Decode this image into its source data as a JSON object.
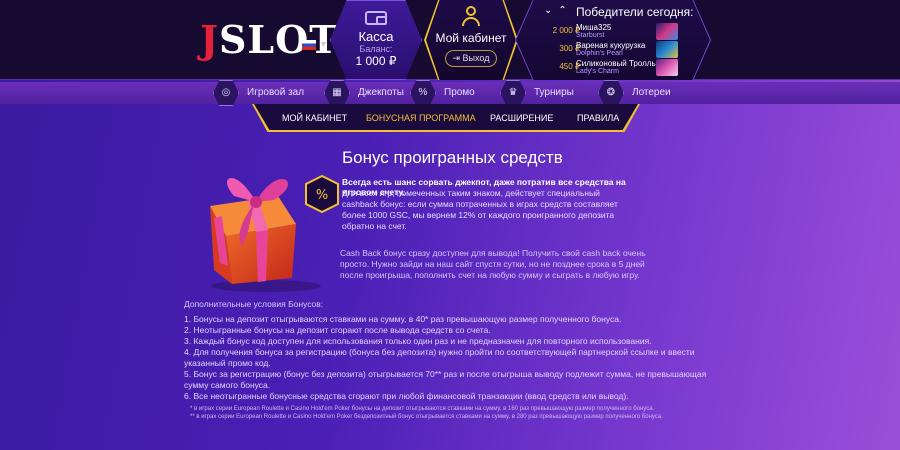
{
  "header": {
    "logo_text": "JSLOT",
    "kassa": {
      "title": "Касса",
      "balance_label": "Баланс:",
      "balance_amount": "1 000 ₽"
    },
    "cabinet": {
      "title": "Мой кабинет",
      "logout_label": "Выход"
    },
    "winners": {
      "title": "Победители сегодня:",
      "rows": [
        {
          "amount": "2 000 ₽",
          "name": "Миша325",
          "game": "Starburst"
        },
        {
          "amount": "300 ₽",
          "name": "Вареная кукурузка",
          "game": "Dolphin's Pearl"
        },
        {
          "amount": "450 ₽",
          "name": "Силиконовый Тролль",
          "game": "Lady's Charm"
        }
      ]
    }
  },
  "main_nav": [
    {
      "label": "Игровой зал",
      "icon": "target-icon"
    },
    {
      "label": "Джекпоты",
      "icon": "slot-reels-icon"
    },
    {
      "label": "Промо",
      "icon": "promo-icon"
    },
    {
      "label": "Турниры",
      "icon": "trophy-icon"
    },
    {
      "label": "Лотереи",
      "icon": "lottery-balls-icon"
    }
  ],
  "sub_nav": [
    {
      "label": "МОЙ КАБИНЕТ",
      "active": false
    },
    {
      "label": "БОНУСНАЯ ПРОГРАММА",
      "active": true
    },
    {
      "label": "РАСШИРЕНИЕ",
      "active": false
    },
    {
      "label": "ПРАВИЛА",
      "active": false
    }
  ],
  "content": {
    "title": "Бонус проигранных средств",
    "lead": "Всегда есть шанс сорвать джекпот, даже потратив все средства на игровом счету.",
    "p1": "Для всех игр, помеченных таким знаком, действует специальный cashback бонус: если сумма потраченных в играх средств составляет более 1000 GSC, мы вернем 12% от каждого проигранного депозита обратно на счет.",
    "p2": "Cash Back бонус сразу доступен для вывода! Получить свой cash back очень просто. Нужно зайди на наш сайт спустя сутки, но не позднее срока в 5 дней после проигрыша, пополнить счет на любую сумму и сыграть в любую игру.",
    "conditions_title": "Дополнительные условия Бонусов:",
    "conditions": [
      "1.  Бонусы на депозит отыгрываются ставками на сумму, в 40* раз превышающую размер полученного бонуса.",
      "2.  Неотыгранные бонусы на депозит сгорают после вывода средств со счета.",
      "3.  Каждый бонус код доступен для использования только один раз и не предназначен для повторного использования.",
      "4.  Для получения бонуса за регистрацию (бонуса без депозита) нужно пройти по соответствующей партнерской ссылке и ввести указанный промо код.",
      "5.  Бонус за регистрацию (бонус без депозита) отыгрывается 70** раз и после отыгрыша выводу подлежит сумма, не превышающая сумму самого бонуса.",
      "6.  Все неотыгранные бонусные средства сгорают при любой финансовой транзакции (ввод средств или вывод)."
    ],
    "footnotes": [
      "* в играх серии European Roulette и Casino Hold'em Poker бонусы на депозит отыгрываются ставками на сумму, в 160 раз превышающую размер полученного бонуса.",
      "** в играх серии European Roulette и Casino Hold'em Poker бездепозитный бонус отыгрывается ставками на сумму, в 280 раз превышающую размер полученного бонуса."
    ]
  },
  "colors": {
    "accent_gold": "#f3c233",
    "logo_red": "#e6223a",
    "header_bg": "#160a30",
    "purple_border": "#7d4ce0"
  }
}
